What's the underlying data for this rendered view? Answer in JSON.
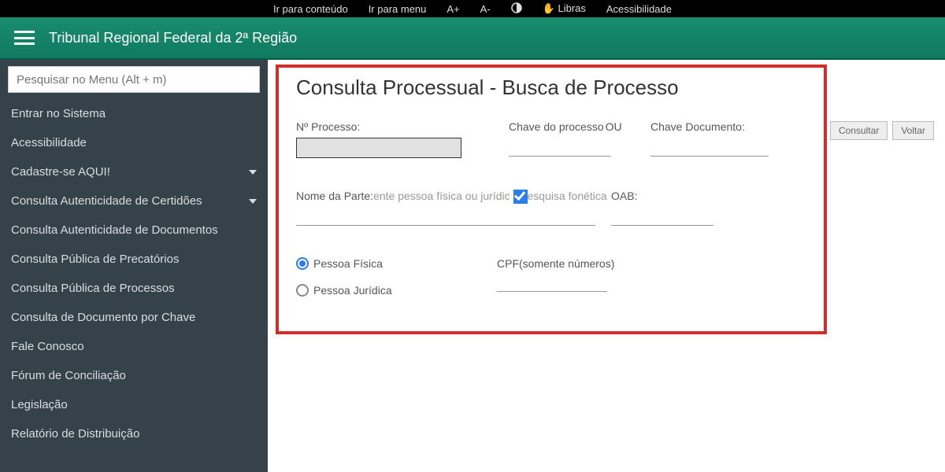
{
  "topbar": {
    "skip_content": "Ir para conteúdo",
    "skip_menu": "Ir para menu",
    "font_inc": "A+",
    "font_dec": "A-",
    "libras": "Libras",
    "accessibility": "Acessibilidade"
  },
  "header": {
    "title": "Tribunal Regional Federal da 2ª Região"
  },
  "sidebar": {
    "search_placeholder": "Pesquisar no Menu (Alt + m)",
    "items": [
      {
        "label": "Entrar no Sistema",
        "expandable": false
      },
      {
        "label": "Acessibilidade",
        "expandable": false
      },
      {
        "label": "Cadastre-se AQUI!",
        "expandable": true
      },
      {
        "label": "Consulta Autenticidade de Certidões",
        "expandable": true
      },
      {
        "label": "Consulta Autenticidade de Documentos",
        "expandable": false
      },
      {
        "label": "Consulta Pública de Precatórios",
        "expandable": false
      },
      {
        "label": "Consulta Pública de Processos",
        "expandable": false
      },
      {
        "label": "Consulta de Documento por Chave",
        "expandable": false
      },
      {
        "label": "Fale Conosco",
        "expandable": false
      },
      {
        "label": "Fórum de Conciliação",
        "expandable": false
      },
      {
        "label": "Legislação",
        "expandable": false
      },
      {
        "label": "Relatório de Distribuição",
        "expandable": false
      }
    ]
  },
  "main": {
    "title": "Consulta Processual - Busca de Processo",
    "labels": {
      "processo": "Nº Processo:",
      "chave_processo": "Chave do processo",
      "ou": "OU",
      "chave_documento": "Chave Documento:",
      "nome_parte": "Nome da Parte:",
      "nome_hint": "ente pessoa física ou jurídic",
      "pesquisa_fonetica": "esquisa fonética",
      "oab": "OAB:",
      "pessoa_fisica": "Pessoa Física",
      "pessoa_juridica": "Pessoa Jurídica",
      "cpf": "CPF",
      "cpf_hint": "(somente números)"
    },
    "values": {
      "processo": "",
      "chave_processo": "",
      "chave_documento": "",
      "nome_parte": "",
      "oab": "",
      "cpf": "",
      "pesquisa_fonetica_checked": true,
      "tipo_pessoa": "fisica"
    },
    "buttons": {
      "consultar": "Consultar",
      "voltar": "Voltar"
    }
  }
}
